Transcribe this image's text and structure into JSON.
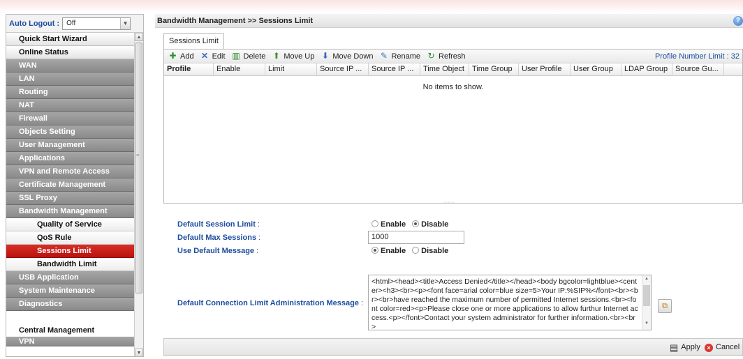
{
  "sidebar": {
    "auto_logout_label": "Auto Logout :",
    "auto_logout_value": "Off",
    "items": [
      {
        "label": "Quick Start Wizard"
      },
      {
        "label": "Online Status"
      },
      {
        "label": "WAN"
      },
      {
        "label": "LAN"
      },
      {
        "label": "Routing"
      },
      {
        "label": "NAT"
      },
      {
        "label": "Firewall"
      },
      {
        "label": "Objects Setting"
      },
      {
        "label": "User Management"
      },
      {
        "label": "Applications"
      },
      {
        "label": "VPN and Remote Access"
      },
      {
        "label": "Certificate Management"
      },
      {
        "label": "SSL Proxy"
      },
      {
        "label": "Bandwidth Management"
      },
      {
        "label": "Quality of Service"
      },
      {
        "label": "QoS Rule"
      },
      {
        "label": "Sessions Limit"
      },
      {
        "label": "Bandwidth Limit"
      },
      {
        "label": "USB Application"
      },
      {
        "label": "System Maintenance"
      },
      {
        "label": "Diagnostics"
      },
      {
        "label": "Central Management"
      },
      {
        "label": "VPN"
      }
    ]
  },
  "breadcrumb": "Bandwidth Management >> Sessions Limit",
  "help_icon": "?",
  "tab_label": "Sessions Limit",
  "toolbar": {
    "add": "Add",
    "edit": "Edit",
    "delete": "Delete",
    "move_up": "Move Up",
    "move_down": "Move Down",
    "rename": "Rename",
    "refresh": "Refresh",
    "profile_limit": "Profile Number Limit : 32"
  },
  "table": {
    "columns": [
      "Profile",
      "Enable",
      "Limit",
      "Source IP ...",
      "Source IP ...",
      "Time Object",
      "Time Group",
      "User Profile",
      "User Group",
      "LDAP Group",
      "Source Gu..."
    ],
    "empty_text": "No items to show."
  },
  "form": {
    "default_session_limit_label": "Default Session Limit",
    "default_max_sessions_label": "Default Max Sessions",
    "use_default_message_label": "Use Default Message",
    "admin_message_label": "Default Connection Limit Administration Message",
    "colon": " :",
    "enable": "Enable",
    "disable": "Disable",
    "session_limit_state": "disable",
    "use_default_message_state": "enable",
    "max_sessions_value": "1000",
    "message_value": "<html><head><title>Access Denied</title></head><body bgcolor=lightblue><center><h3><br><p><font face=arial color=blue size=5>Your IP:%SIP%</font><br><br><br>have reached the maximum number of permitted Internet sessions.<br><font color=red><p>Please close one or more applications to allow furthur Internet access.<p></font>Contact your system administrator for further information.<br><br>"
  },
  "bottom": {
    "apply": "Apply",
    "cancel": "Cancel"
  },
  "colors": {
    "active_menu": "#c41e17",
    "label_blue": "#1c4da0",
    "menu_gray": "#959595"
  }
}
